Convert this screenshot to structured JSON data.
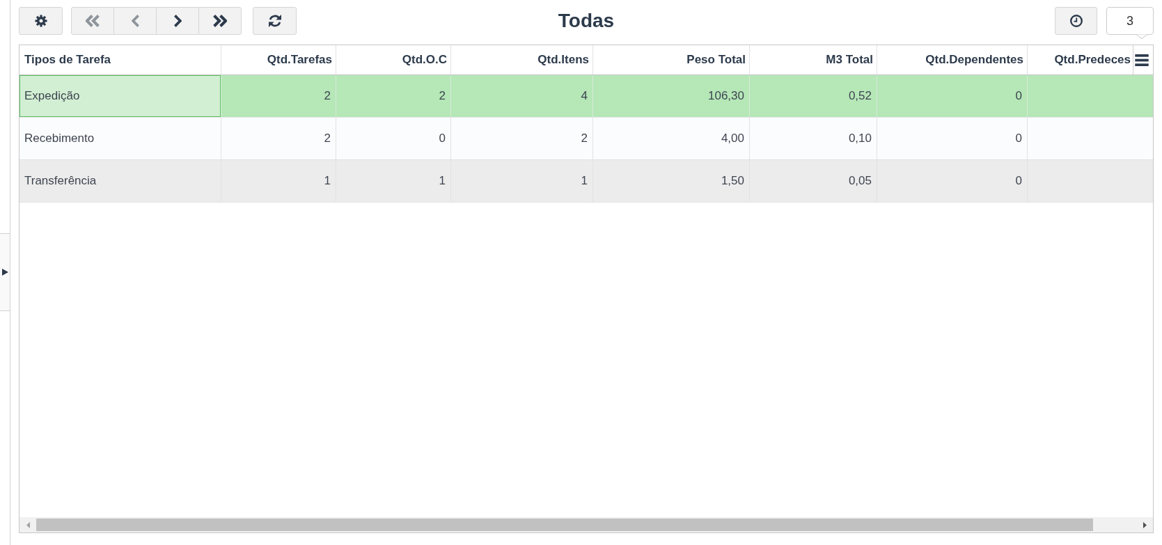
{
  "sidebar": {
    "expanded": false
  },
  "toolbar": {
    "nav_buttons": [
      {
        "kind": "first",
        "disabled": true
      },
      {
        "kind": "prev",
        "disabled": true
      },
      {
        "kind": "next",
        "disabled": false
      },
      {
        "kind": "last",
        "disabled": false
      }
    ],
    "title": "Todas",
    "count": "3"
  },
  "table": {
    "columns": [
      {
        "label": "Tipos de Tarefa",
        "kind": "text"
      },
      {
        "label": "Qtd.Tarefas",
        "kind": "number"
      },
      {
        "label": "Qtd.O.C",
        "kind": "number"
      },
      {
        "label": "Qtd.Itens",
        "kind": "number"
      },
      {
        "label": "Peso Total",
        "kind": "number"
      },
      {
        "label": "M3 Total",
        "kind": "number"
      },
      {
        "label": "Qtd.Dependentes",
        "kind": "number"
      },
      {
        "label": "Qtd.Predeces",
        "kind": "number"
      }
    ],
    "rows": [
      {
        "cells": [
          "Expedição",
          "2",
          "2",
          "4",
          "106,30",
          "0,52",
          "0"
        ],
        "selected": true,
        "hovered": false
      },
      {
        "cells": [
          "Recebimento",
          "2",
          "0",
          "2",
          "4,00",
          "0,10",
          "0"
        ],
        "selected": false,
        "hovered": false
      },
      {
        "cells": [
          "Transferência",
          "1",
          "1",
          "1",
          "1,50",
          "0,05",
          "0"
        ],
        "selected": false,
        "hovered": true
      }
    ]
  }
}
